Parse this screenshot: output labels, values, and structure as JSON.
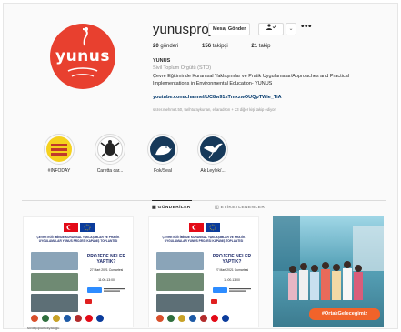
{
  "profile": {
    "avatar_text": "yunus",
    "username": "yunusproje",
    "message_button": "Mesaj Gönder",
    "more_label": "•••",
    "stats": {
      "posts_count": "20",
      "posts_label": "gönderi",
      "followers_count": "156",
      "followers_label": "takipçi",
      "following_count": "21",
      "following_label": "takip"
    },
    "name": "YUNUS",
    "category": "Sivil Toplum Örgütü (STÖ)",
    "bio": "Çevre Eğitiminde Kuramsal Yaklaşımlar ve Pratik Uygulamalar/Approaches and Practical Implementations in Environmental Education- YUNUS",
    "link": "youtube.com/channel/UC8w91sTmxzwOUQpTWie_TiA",
    "followed_by": "sezer.mehmet.50, tarihturaykurlan, elfaradson + 23 diğer kişi takip ediyor"
  },
  "highlights": [
    {
      "label": "#INFODAY",
      "icon": "infoday-icon",
      "badge": "BİLGİ GÜNÜNDE BURADA"
    },
    {
      "label": "Caretta car...",
      "icon": "turtle-icon"
    },
    {
      "label": "Fok/Seal",
      "icon": "seal-icon"
    },
    {
      "label": "Ak Leylek/...",
      "icon": "stork-icon"
    }
  ],
  "tabs": {
    "posts": "GÖNDERİLER",
    "tagged": "ETİKETLENENLER"
  },
  "posts": [
    {
      "title": "ÇEVRE EĞİTİMİNDE KURAMSAL YAKLAŞIMLAR VE PRATİK UYGULAMALAR YUNUS PROJESİ KAPANIŞ TOPLANTISI",
      "question": "PROJEDE NELER YAPTIK?",
      "date": "27 Mart 2021 Cumartesi",
      "time": "11:00-13:00"
    },
    {
      "title": "ÇEVRE EĞİTİMİNDE KURAMSAL YAKLAŞIMLAR VE PRATİK UYGULAMALAR YUNUS PROJESİ KAPANIŞ TOPLANTISI",
      "question": "PROJEDE NELER YAPTIK?",
      "date": "27 Mart 2021 Cumartesi",
      "time": "11:00-13:00"
    },
    {
      "tag": "#OrtakGelecegimiz"
    }
  ],
  "bottom_note": "sivilsjoplumdiyalogu",
  "colors": {
    "avatar_bg": "#e8402f",
    "link": "#00376b",
    "muted": "#8e8e8e",
    "tag_bg": "#f1632a"
  }
}
